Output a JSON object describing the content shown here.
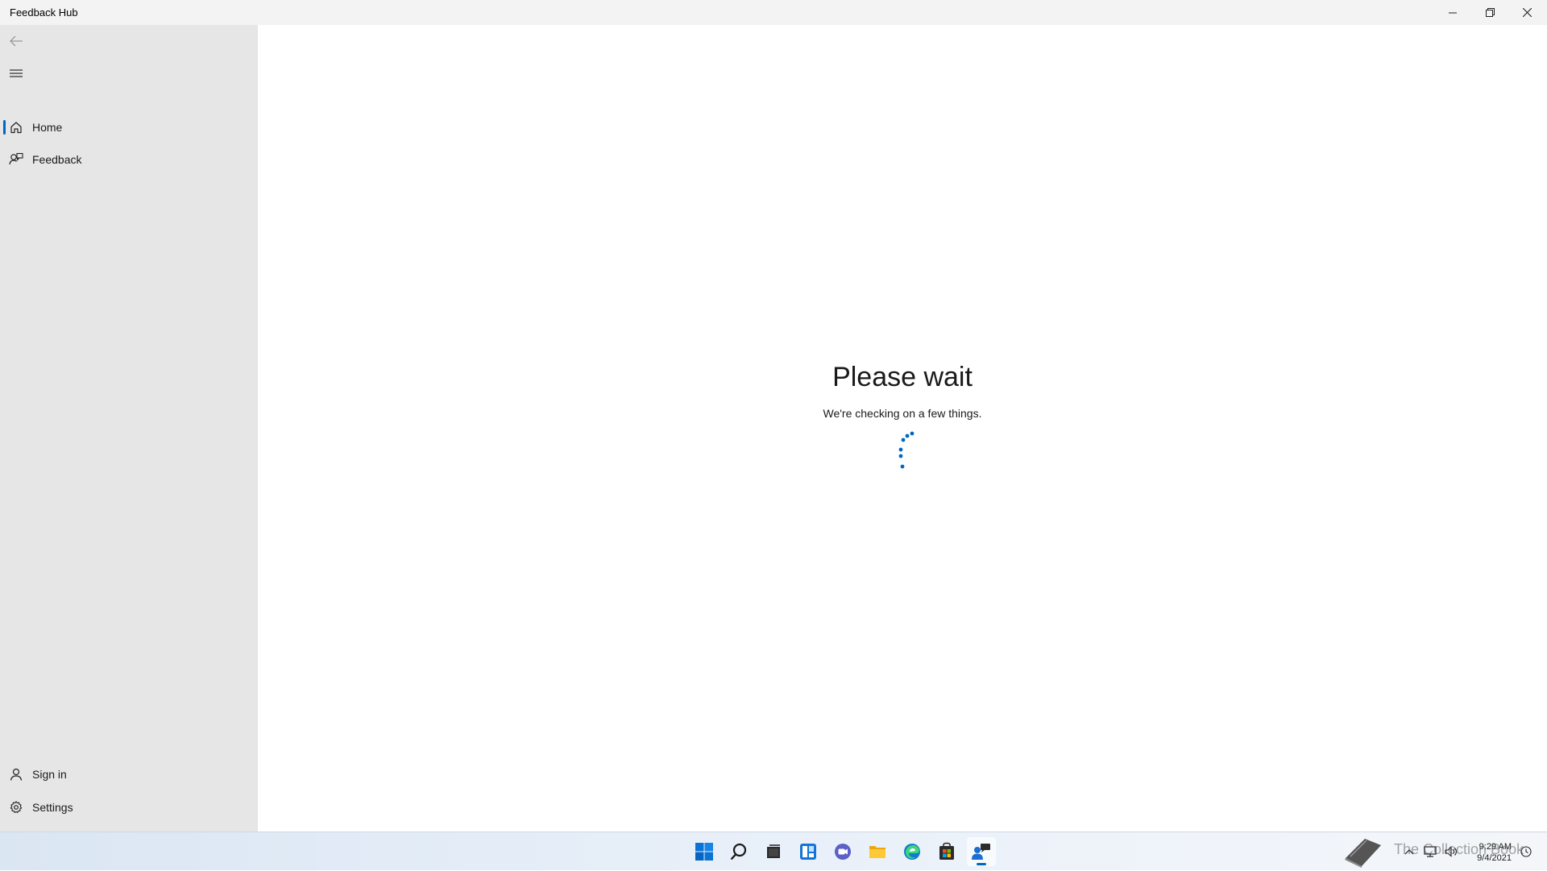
{
  "window": {
    "title": "Feedback Hub",
    "controls": [
      "minimize",
      "restore",
      "close"
    ]
  },
  "sidebar": {
    "back_icon": "back-arrow-icon",
    "menu_icon": "hamburger-menu-icon",
    "items": [
      {
        "label": "Home",
        "icon": "home-icon",
        "selected": true
      },
      {
        "label": "Feedback",
        "icon": "feedback-icon",
        "selected": false
      }
    ],
    "footer": [
      {
        "label": "Sign in",
        "icon": "person-icon"
      },
      {
        "label": "Settings",
        "icon": "gear-icon"
      }
    ]
  },
  "main": {
    "title": "Please wait",
    "subtitle": "We're checking on a few things.",
    "spinner_color": "#0067c0"
  },
  "taskbar": {
    "apps": [
      "start-icon",
      "search-icon",
      "task-view-icon",
      "widgets-icon",
      "chat-icon",
      "file-explorer-icon",
      "edge-icon",
      "store-icon",
      "feedback-hub-icon"
    ],
    "active_app": "feedback-hub-icon",
    "clock": {
      "time": "9:29 AM",
      "date": "9/4/2021"
    },
    "watermark": "The Collection Book"
  },
  "colors": {
    "accent": "#0067c0",
    "sidebar_bg": "#e6e6e6",
    "titlebar_bg": "#f3f3f3"
  }
}
